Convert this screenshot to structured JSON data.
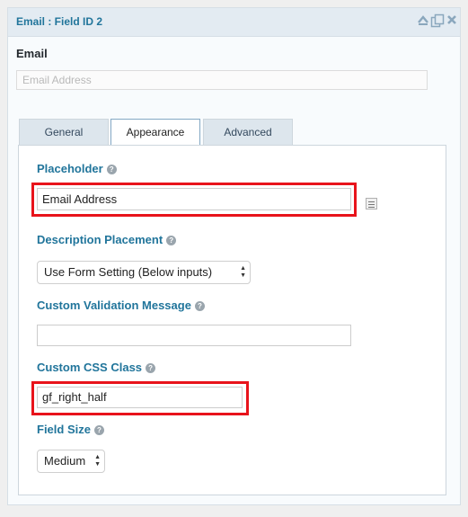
{
  "header": {
    "title": "Email : Field ID 2",
    "icons": [
      "collapse-icon",
      "duplicate-icon",
      "delete-icon"
    ]
  },
  "preview": {
    "label": "Email",
    "placeholder": "Email Address"
  },
  "tabs": [
    {
      "label": "General",
      "active": false
    },
    {
      "label": "Appearance",
      "active": true
    },
    {
      "label": "Advanced",
      "active": false
    }
  ],
  "settings": {
    "placeholder": {
      "label": "Placeholder",
      "value": "Email Address"
    },
    "description_placement": {
      "label": "Description Placement",
      "value": "Use Form Setting (Below inputs)"
    },
    "custom_validation": {
      "label": "Custom Validation Message",
      "value": ""
    },
    "custom_css": {
      "label": "Custom CSS Class",
      "value": "gf_right_half"
    },
    "field_size": {
      "label": "Field Size",
      "value": "Medium"
    }
  },
  "colors": {
    "accent": "#21759b",
    "highlight": "#e8131b"
  }
}
